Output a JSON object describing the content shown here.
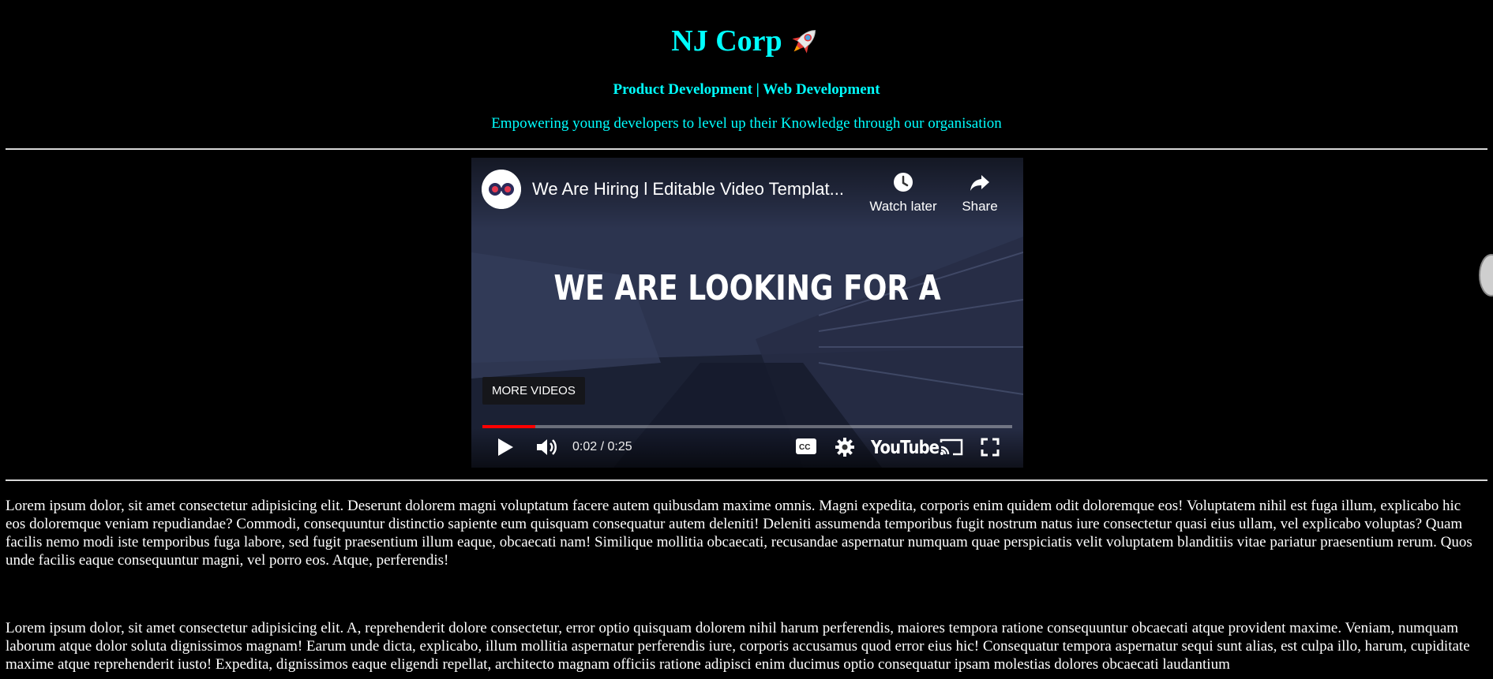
{
  "header": {
    "title": "NJ Corp",
    "subtitle": "Product Development | Web Development",
    "tagline": "Empowering young developers to level up their Knowledge through our organisation"
  },
  "video": {
    "title": "We Are Hiring l Editable Video Templat...",
    "watch_later_label": "Watch later",
    "share_label": "Share",
    "overlay_text": "WE ARE LOOKING FOR A",
    "more_videos_label": "MORE VIDEOS",
    "time": "0:02 / 0:25",
    "progress": 0.1,
    "logo_text": "YouTube"
  },
  "content": {
    "paragraph1": "Lorem ipsum dolor, sit amet consectetur adipisicing elit. Deserunt dolorem magni voluptatum facere autem quibusdam maxime omnis. Magni expedita, corporis enim quidem odit doloremque eos! Voluptatem nihil est fuga illum, explicabo hic eos doloremque veniam repudiandae? Commodi, consequuntur distinctio sapiente eum quisquam consequatur autem deleniti! Deleniti assumenda temporibus fugit nostrum natus iure consectetur quasi eius ullam, vel explicabo voluptas? Quam facilis nemo modi iste temporibus fuga labore, sed fugit praesentium illum eaque, obcaecati nam! Similique mollitia obcaecati, recusandae aspernatur numquam quae perspiciatis velit voluptatem blanditiis vitae pariatur praesentium rerum. Quos unde facilis eaque consequuntur magni, vel porro eos. Atque, perferendis!",
    "paragraph2": "Lorem ipsum dolor, sit amet consectetur adipisicing elit. A, reprehenderit dolore consectetur, error optio quisquam dolorem nihil harum perferendis, maiores tempora ratione consequuntur obcaecati atque provident maxime. Veniam, numquam laborum atque dolor soluta dignissimos magnam! Earum unde dicta, explicabo, illum mollitia aspernatur perferendis iure, corporis accusamus quod error eius hic! Consequatur tempora aspernatur sequi sunt alias, est culpa illo, harum, cupiditate maxime atque reprehenderit iusto! Expedita, dignissimos eaque eligendi repellat, architecto magnam officiis ratione adipisci enim ducimus optio consequatur ipsam molestias dolores obcaecati laudantium"
  },
  "colors": {
    "accent": "#00ffff",
    "background": "#000000",
    "progress": "#ff0000"
  },
  "icons": [
    "rocket-icon",
    "channel-avatar",
    "clock-icon",
    "share-icon",
    "play-icon",
    "volume-icon",
    "captions-icon",
    "settings-icon",
    "cast-icon",
    "fullscreen-icon"
  ]
}
